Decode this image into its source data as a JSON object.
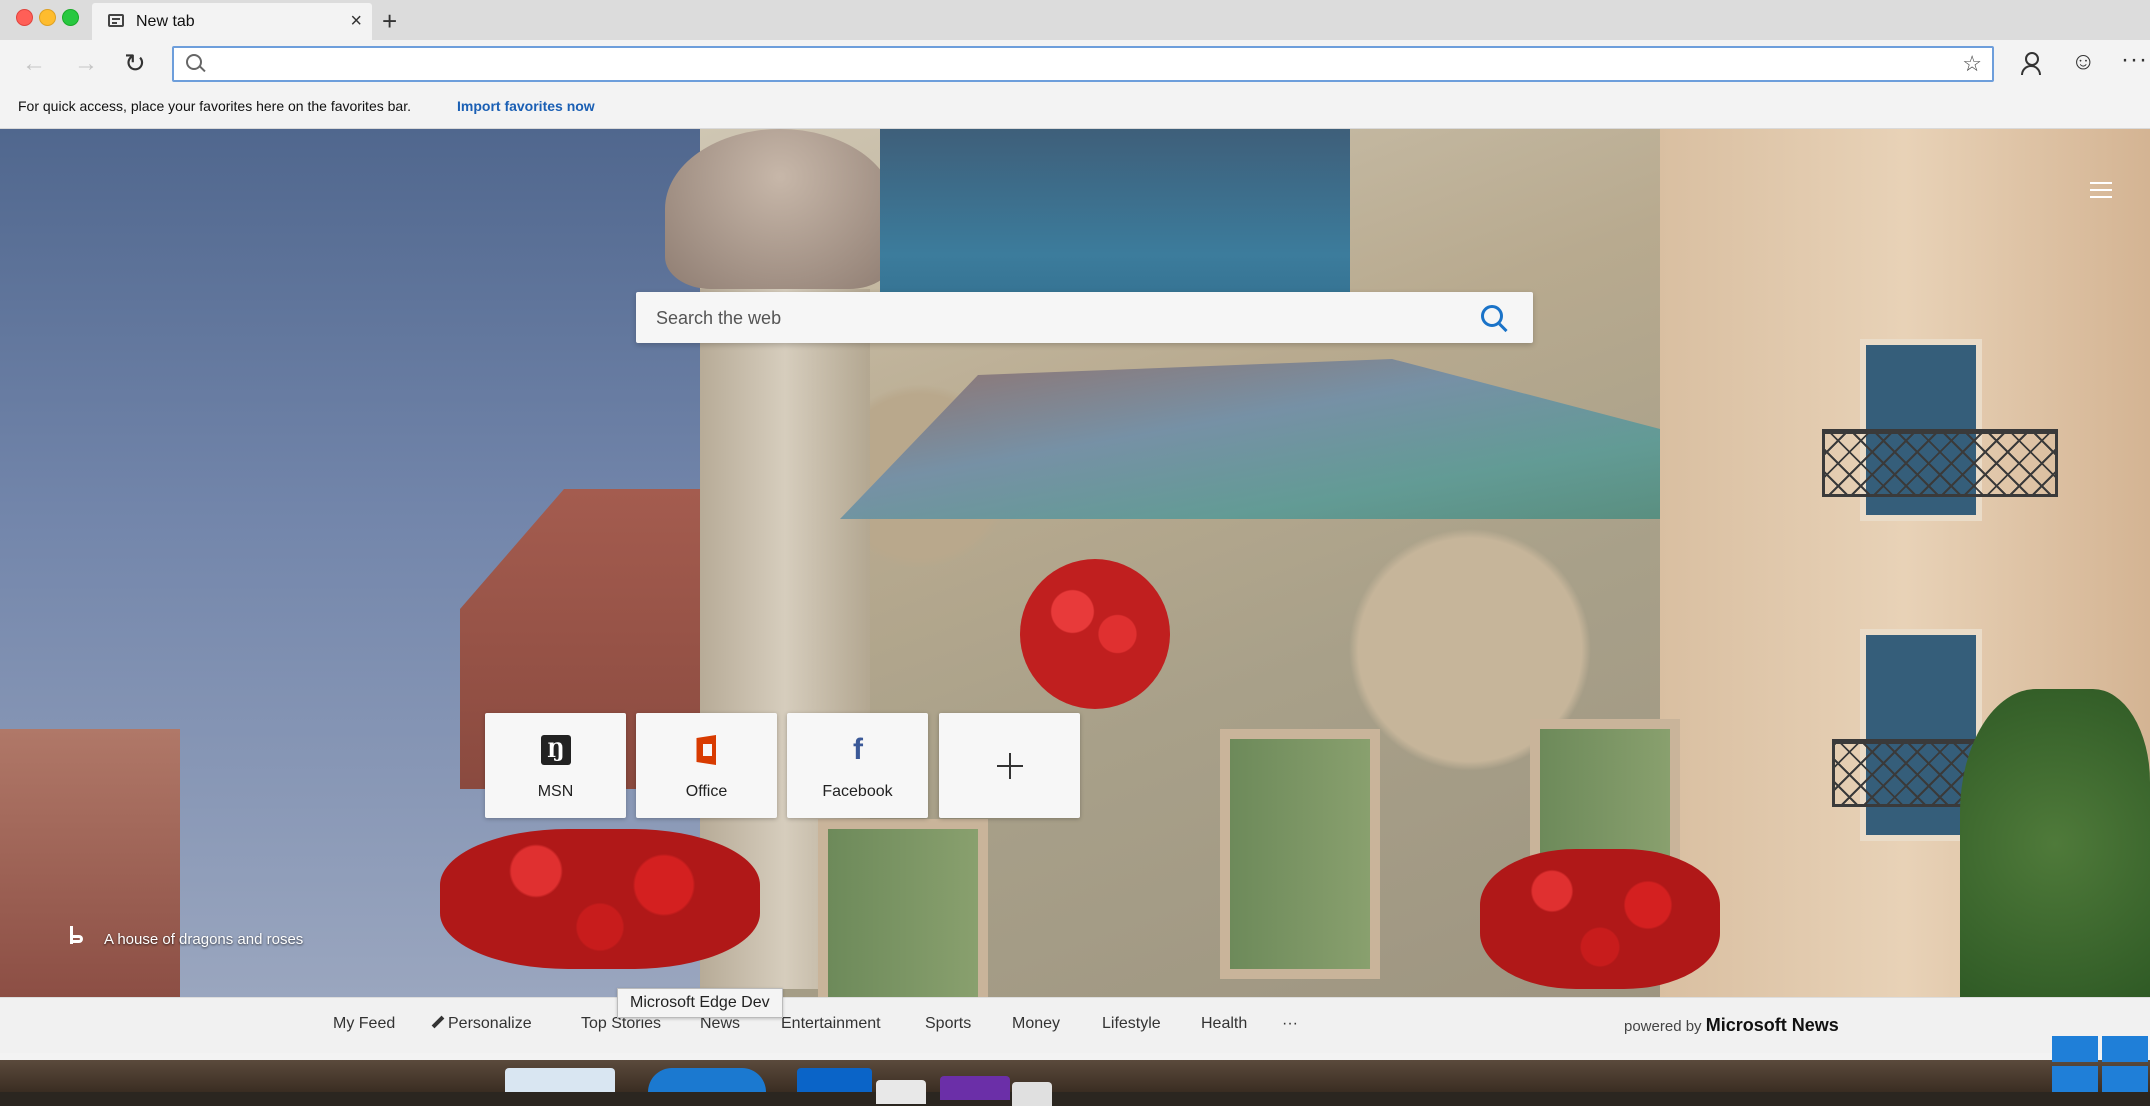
{
  "tab": {
    "title": "New tab",
    "close": "×",
    "new_tab": "+"
  },
  "toolbar": {
    "back": "←",
    "forward": "→",
    "refresh": "↻",
    "address_value": "",
    "address_placeholder": "",
    "favorite": "☆",
    "emoji": "☺",
    "more": "···"
  },
  "favbar": {
    "message": "For quick access, place your favorites here on the favorites bar.",
    "import_link": "Import favorites now"
  },
  "search": {
    "placeholder": "Search the web"
  },
  "tiles": [
    {
      "label": "MSN",
      "icon": "msn-icon"
    },
    {
      "label": "Office",
      "icon": "office-icon"
    },
    {
      "label": "Facebook",
      "icon": "facebook-icon"
    },
    {
      "label": "",
      "icon": "plus-icon"
    }
  ],
  "msn_glyph": "Ŋ",
  "fb_glyph": "f",
  "caption": "A house of dragons and roses",
  "news": {
    "items": [
      "My Feed",
      "Personalize",
      "Top Stories",
      "News",
      "Entertainment",
      "Sports",
      "Money",
      "Lifestyle",
      "Health",
      "···"
    ],
    "powered_by": "powered by",
    "brand": "Microsoft News"
  },
  "tooltip": "Microsoft Edge Dev",
  "colors": {
    "accent": "#1a73c8",
    "link": "#1a5fb4",
    "address_border": "#6d9edb"
  }
}
